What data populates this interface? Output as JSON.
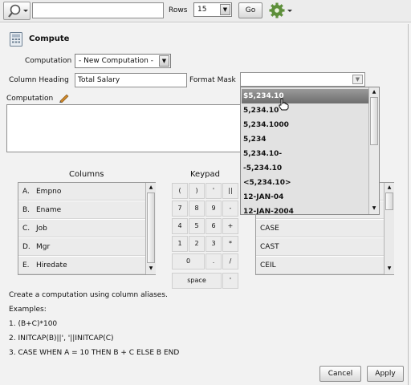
{
  "toolbar": {
    "search_placeholder": "",
    "rows_label": "Rows",
    "rows_value": "15",
    "go_label": "Go",
    "icons": [
      "search-icon",
      "gear-icon",
      "chevron-down-icon"
    ]
  },
  "dialog": {
    "title": "Compute",
    "computation_label": "Computation",
    "computation_value": "- New Computation -",
    "column_heading_label": "Column Heading",
    "column_heading_value": "Total Salary",
    "format_mask_label": "Format Mask",
    "format_mask_value": "",
    "expression_label": "Computation",
    "expression_value": ""
  },
  "format_options": [
    {
      "label": "$5,234.10",
      "selected": true
    },
    {
      "label": "5,234.10",
      "selected": false
    },
    {
      "label": "5,234.1000",
      "selected": false
    },
    {
      "label": "5,234",
      "selected": false
    },
    {
      "label": "5,234.10-",
      "selected": false
    },
    {
      "label": "-5,234.10",
      "selected": false
    },
    {
      "label": "<5,234.10>",
      "selected": false
    },
    {
      "label": "12-JAN-04",
      "selected": false
    },
    {
      "label": "12-JAN-2004",
      "selected": false
    }
  ],
  "columns": {
    "heading": "Columns",
    "items": [
      {
        "letter": "A.",
        "name": "Empno"
      },
      {
        "letter": "B.",
        "name": "Ename"
      },
      {
        "letter": "C.",
        "name": "Job"
      },
      {
        "letter": "D.",
        "name": "Mgr"
      },
      {
        "letter": "E.",
        "name": "Hiredate"
      }
    ]
  },
  "keypad": {
    "heading": "Keypad",
    "rows": [
      [
        "(",
        ")",
        "'",
        "||"
      ],
      [
        "7",
        "8",
        "9",
        "-"
      ],
      [
        "4",
        "5",
        "6",
        "+"
      ],
      [
        "1",
        "2",
        "3",
        "*"
      ],
      [
        "0",
        ".",
        "/"
      ],
      [
        "space",
        "'"
      ]
    ]
  },
  "functions": {
    "items": [
      "CASE",
      "CAST",
      "CEIL"
    ]
  },
  "help": {
    "intro": "Create a computation using column aliases.",
    "examples_label": "Examples:",
    "examples": [
      "1. (B+C)*100",
      "2. INITCAP(B)||', '||INITCAP(C)",
      "3. CASE WHEN A = 10 THEN B + C ELSE B END"
    ]
  },
  "actions": {
    "cancel": "Cancel",
    "apply": "Apply"
  }
}
